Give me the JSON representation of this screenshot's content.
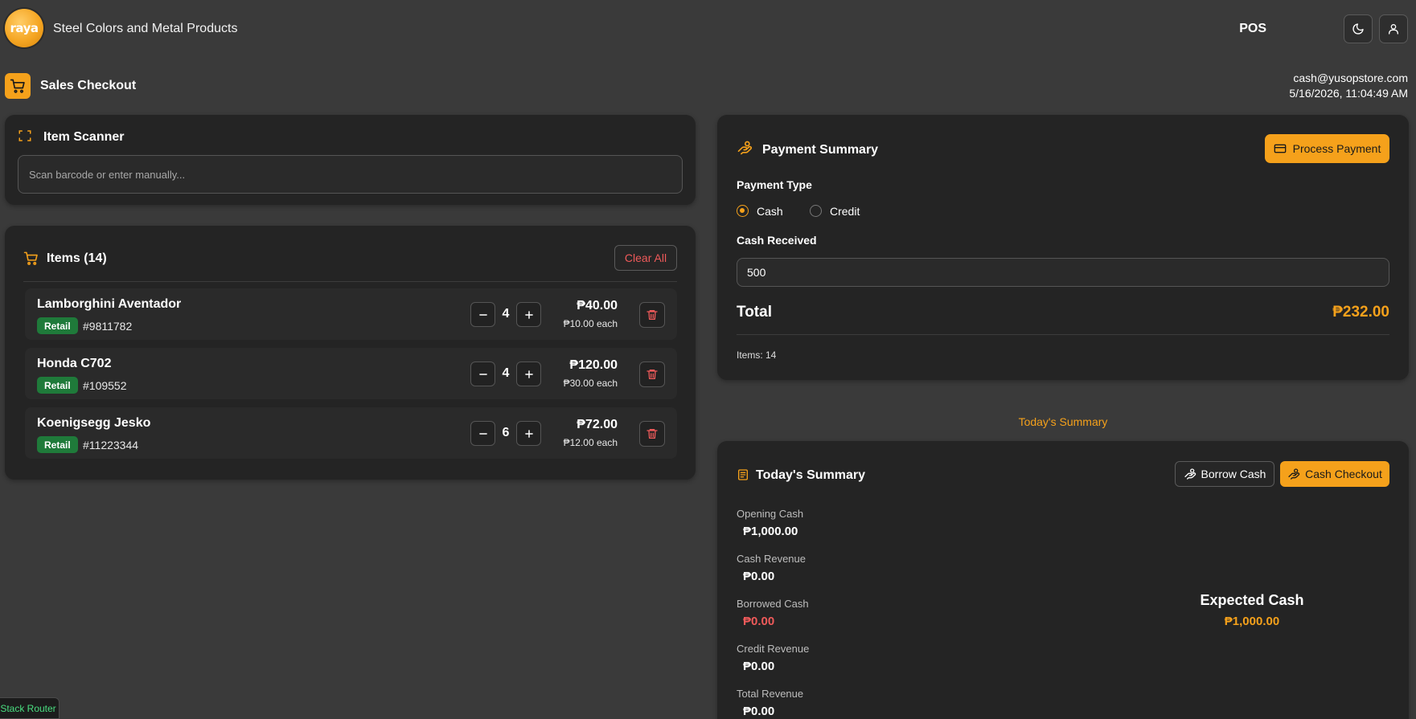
{
  "header": {
    "logo_text": "raya",
    "company_name": "Steel Colors and Metal Products",
    "mode_label": "POS"
  },
  "page": {
    "title": "Sales Checkout",
    "user_email": "cash@yusopstore.com",
    "datetime": "5/16/2026, 11:04:49 AM"
  },
  "scanner": {
    "title": "Item Scanner",
    "placeholder": "Scan barcode or enter manually..."
  },
  "items_panel": {
    "title": "Items (14)",
    "clear_label": "Clear All",
    "items": [
      {
        "name": "Lamborghini Aventador",
        "badge": "Retail",
        "sku": "#9811782",
        "qty": "4",
        "total": "₱40.00",
        "unit": "₱10.00 each"
      },
      {
        "name": "Honda C702",
        "badge": "Retail",
        "sku": "#109552",
        "qty": "4",
        "total": "₱120.00",
        "unit": "₱30.00 each"
      },
      {
        "name": "Koenigsegg Jesko",
        "badge": "Retail",
        "sku": "#11223344",
        "qty": "6",
        "total": "₱72.00",
        "unit": "₱12.00 each"
      }
    ]
  },
  "payment": {
    "title": "Payment Summary",
    "process_label": "Process Payment",
    "type_label": "Payment Type",
    "options": [
      "Cash",
      "Credit"
    ],
    "selected": "Cash",
    "cash_received_label": "Cash Received",
    "cash_received_value": "500",
    "total_label": "Total",
    "total_value": "₱232.00",
    "items_count": "Items: 14"
  },
  "todays_link": "Today's Summary",
  "summary": {
    "title": "Today's Summary",
    "borrow_label": "Borrow Cash",
    "checkout_label": "Cash Checkout",
    "stats": [
      {
        "label": "Opening Cash",
        "value": "₱1,000.00"
      },
      {
        "label": "Cash Revenue",
        "value": "₱0.00"
      },
      {
        "label": "Borrowed Cash",
        "value": "₱0.00"
      },
      {
        "label": "Credit Revenue",
        "value": "₱0.00"
      },
      {
        "label": "Total Revenue",
        "value": "₱0.00"
      }
    ],
    "expected_label": "Expected Cash",
    "expected_value": "₱1,000.00"
  },
  "devtools": {
    "label": "Stack Router"
  },
  "colors": {
    "accent": "#f5a11b",
    "danger": "#ef5a5a",
    "badge": "#1f7a3a",
    "background": "#3a3a3a",
    "card": "#242424"
  }
}
